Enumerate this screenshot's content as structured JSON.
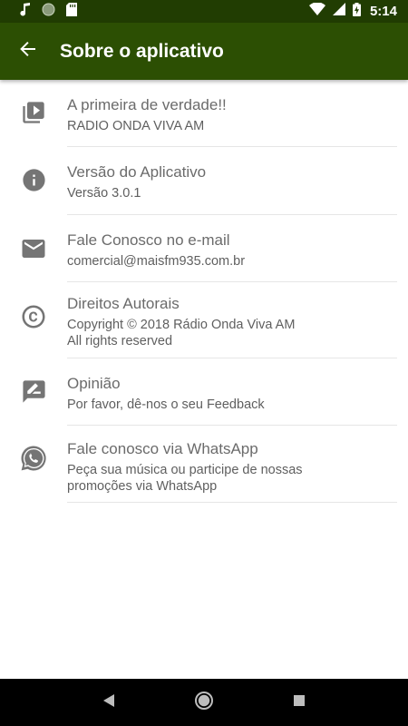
{
  "status_bar": {
    "time": "5:14",
    "icons": [
      "music-note-icon",
      "globe-icon",
      "sd-card-icon",
      "wifi-icon",
      "signal-icon",
      "battery-charging-icon"
    ]
  },
  "app_bar": {
    "title": "Sobre o aplicativo",
    "back_icon": "arrow-back-icon"
  },
  "items": [
    {
      "icon": "video-library-icon",
      "title": "A primeira de verdade!!",
      "subtitle": "RADIO ONDA VIVA AM"
    },
    {
      "icon": "info-icon",
      "title": "Versão do Aplicativo",
      "subtitle": "Versão 3.0.1"
    },
    {
      "icon": "email-icon",
      "title": "Fale Conosco no e-mail",
      "subtitle": "comercial@maisfm935.com.br"
    },
    {
      "icon": "copyright-icon",
      "title": "Direitos Autorais",
      "subtitle": "Copyright © 2018 Rádio Onda Viva AM\n All rights reserved"
    },
    {
      "icon": "feedback-icon",
      "title": "Opinião",
      "subtitle": "Por favor, dê-nos o seu Feedback"
    },
    {
      "icon": "whatsapp-icon",
      "title": "Fale conosco via WhatsApp",
      "subtitle": "Peça sua música ou participe de nossas\npromoções via WhatsApp"
    }
  ],
  "nav_bar": {
    "icons": [
      "back-triangle-icon",
      "home-circle-icon",
      "recents-square-icon"
    ]
  },
  "colors": {
    "status_bar": "#213d02",
    "app_bar": "#2c4f03",
    "icon_gray": "#757575"
  }
}
